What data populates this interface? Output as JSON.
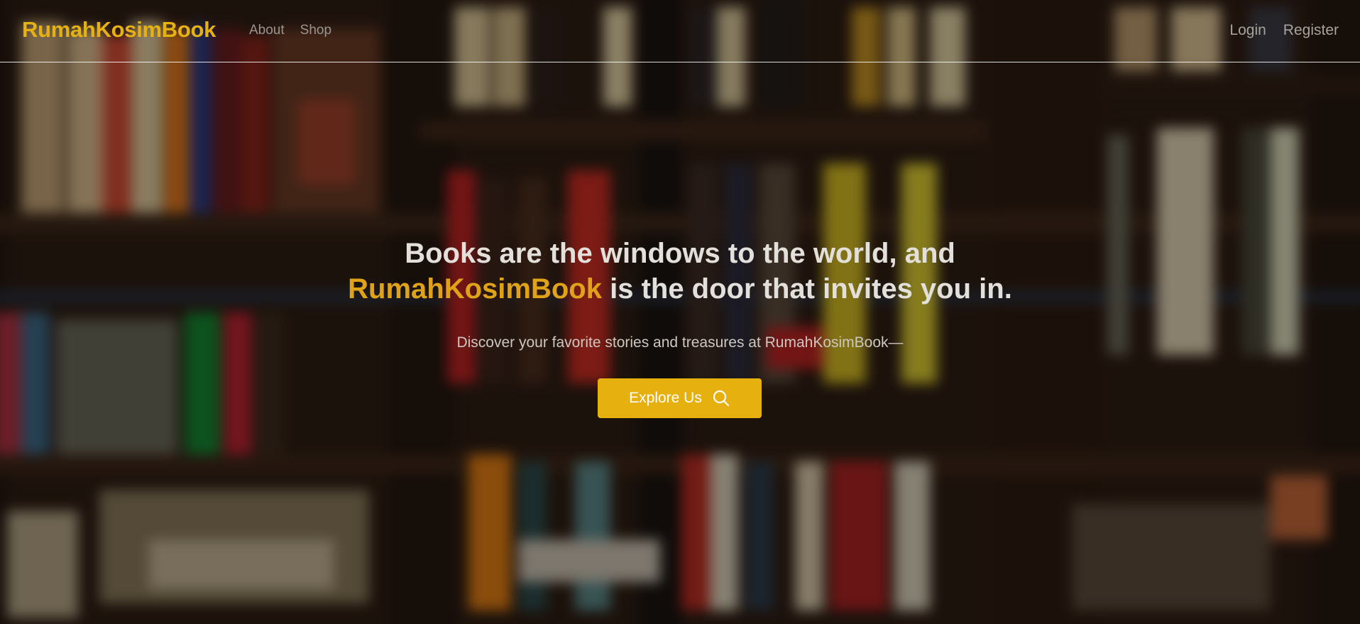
{
  "nav": {
    "brand": "RumahKosimBook",
    "links": [
      {
        "label": "About"
      },
      {
        "label": "Shop"
      }
    ],
    "auth": {
      "login": "Login",
      "register": "Register"
    }
  },
  "hero": {
    "headline_line1": "Books are the windows to the world, and",
    "headline_brand": "RumahKosimBook",
    "headline_rest": " is the door that invites you in.",
    "subtext": "Discover your favorite stories and treasures at RumahKosimBook—",
    "cta_label": "Explore Us",
    "cta_icon": "search-icon"
  },
  "colors": {
    "accent": "#e6b212",
    "button": "#e6b00f"
  }
}
